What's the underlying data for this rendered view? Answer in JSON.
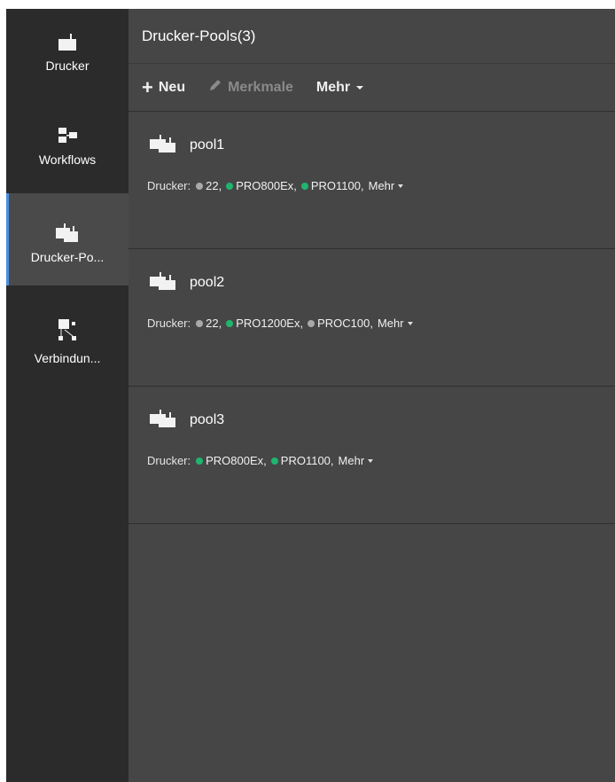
{
  "sidebar": {
    "items": [
      {
        "label": "Drucker",
        "icon": "printer-icon"
      },
      {
        "label": "Workflows",
        "icon": "workflow-icon"
      },
      {
        "label": "Drucker-Po...",
        "icon": "printer-pool-icon",
        "active": true
      },
      {
        "label": "Verbindun...",
        "icon": "connection-icon"
      }
    ]
  },
  "header": {
    "title": "Drucker-Pools(3)"
  },
  "toolbar": {
    "new_label": "Neu",
    "properties_label": "Merkmale",
    "more_label": "Mehr"
  },
  "pools": [
    {
      "name": "pool1",
      "printers_label": "Drucker:",
      "printers": [
        {
          "name": "22,",
          "status": "grey"
        },
        {
          "name": "PRO800Ex,",
          "status": "green"
        },
        {
          "name": "PRO1100,",
          "status": "green"
        }
      ],
      "more_label": "Mehr"
    },
    {
      "name": "pool2",
      "printers_label": "Drucker:",
      "printers": [
        {
          "name": "22,",
          "status": "grey"
        },
        {
          "name": "PRO1200Ex,",
          "status": "green"
        },
        {
          "name": "PROC100,",
          "status": "grey"
        }
      ],
      "more_label": "Mehr"
    },
    {
      "name": "pool3",
      "printers_label": "Drucker:",
      "printers": [
        {
          "name": "PRO800Ex,",
          "status": "green"
        },
        {
          "name": "PRO1100,",
          "status": "green"
        }
      ],
      "more_label": "Mehr"
    }
  ],
  "colors": {
    "accent": "#4a90e2",
    "status_green": "#1fb56f",
    "status_grey": "#a9a9a9"
  }
}
